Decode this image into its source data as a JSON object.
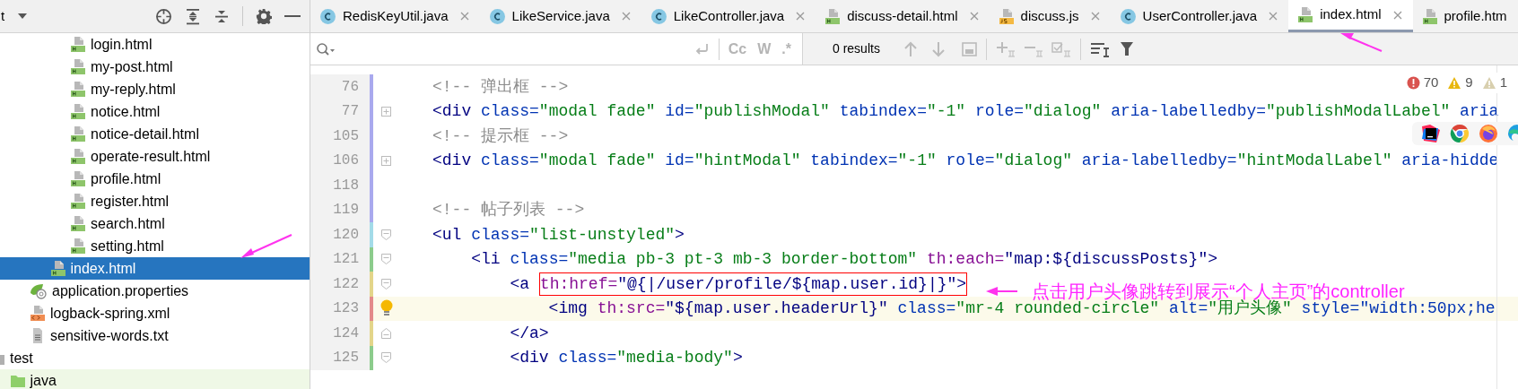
{
  "sidebar": {
    "title": "t",
    "tree": [
      {
        "children": [
          {
            "children": [
              {
                "children": [
                  {
                    "children": [
                      {
                        "label": "login.html",
                        "kind": "html",
                        "selected": false
                      },
                      {
                        "label": "my-post.html",
                        "kind": "html",
                        "selected": false
                      },
                      {
                        "label": "my-reply.html",
                        "kind": "html",
                        "selected": false
                      },
                      {
                        "label": "notice.html",
                        "kind": "html",
                        "selected": false
                      },
                      {
                        "label": "notice-detail.html",
                        "kind": "html",
                        "selected": false
                      },
                      {
                        "label": "operate-result.html",
                        "kind": "html",
                        "selected": false
                      },
                      {
                        "label": "profile.html",
                        "kind": "html",
                        "selected": false
                      },
                      {
                        "label": "register.html",
                        "kind": "html",
                        "selected": false
                      },
                      {
                        "label": "search.html",
                        "kind": "html",
                        "selected": false
                      },
                      {
                        "label": "setting.html",
                        "kind": "html",
                        "selected": false
                      }
                    ]
                  },
                  {
                    "label": "index.html",
                    "kind": "html",
                    "selected": true
                  }
                ]
              },
              {
                "label": "application.properties",
                "kind": "properties",
                "selected": false
              },
              {
                "label": "logback-spring.xml",
                "kind": "xml",
                "selected": false
              },
              {
                "label": "sensitive-words.txt",
                "kind": "text",
                "selected": false
              }
            ]
          }
        ]
      },
      {
        "label": "test",
        "kind": "folder",
        "selected": false,
        "children": [
          {
            "label": "java",
            "kind": "test-folder",
            "selected": false
          }
        ]
      }
    ]
  },
  "tabs": [
    {
      "label": "RedisKeyUtil.java",
      "kind": "java",
      "selected": false,
      "closable": true
    },
    {
      "label": "LikeService.java",
      "kind": "java",
      "selected": false,
      "closable": true
    },
    {
      "label": "LikeController.java",
      "kind": "java",
      "selected": false,
      "closable": true
    },
    {
      "label": "discuss-detail.html",
      "kind": "html",
      "selected": false,
      "closable": true
    },
    {
      "label": "discuss.js",
      "kind": "js",
      "selected": false,
      "closable": true
    },
    {
      "label": "UserController.java",
      "kind": "java",
      "selected": false,
      "closable": true
    },
    {
      "label": "index.html",
      "kind": "html",
      "selected": true,
      "closable": true
    },
    {
      "label": "profile.htm",
      "kind": "html",
      "selected": false,
      "closable": false
    }
  ],
  "find": {
    "options": [
      "Cc",
      "W",
      ".*"
    ],
    "results": "0 results"
  },
  "inspections": [
    {
      "kind": "error",
      "count": "70"
    },
    {
      "kind": "warning",
      "count": "9"
    },
    {
      "kind": "weak",
      "count": "1"
    }
  ],
  "editor": {
    "lines": [
      {
        "number": "76",
        "color": "#a9a9ee",
        "current": false,
        "code": [
          {
            "kind": "comment",
            "text": "<!-- 弹出框 -->"
          }
        ]
      },
      {
        "number": "77",
        "color": "#a9a9ee",
        "current": false,
        "kind": "collapsed",
        "code": [
          {
            "kind": "tag",
            "text": "<div"
          },
          {
            "kind": "attr",
            "text": " class="
          },
          {
            "kind": "value",
            "text": "\"modal fade\""
          },
          {
            "kind": "attr",
            "text": " id="
          },
          {
            "kind": "value",
            "text": "\"publishModal\""
          },
          {
            "kind": "attr",
            "text": " tabindex="
          },
          {
            "kind": "value",
            "text": "\"-1\""
          },
          {
            "kind": "attr",
            "text": " role="
          },
          {
            "kind": "value",
            "text": "\"dialog\""
          },
          {
            "kind": "attr",
            "text": " aria-labelledby="
          },
          {
            "kind": "value",
            "text": "\"publishModalLabel\""
          },
          {
            "kind": "attr",
            "text": " aria"
          }
        ]
      },
      {
        "number": "105",
        "color": "#a9a9ee",
        "current": false,
        "code": [
          {
            "kind": "comment",
            "text": "<!-- 提示框 -->"
          }
        ]
      },
      {
        "number": "106",
        "color": "#a9a9ee",
        "current": false,
        "kind": "collapsed",
        "code": [
          {
            "kind": "tag",
            "text": "<div"
          },
          {
            "kind": "attr",
            "text": " class="
          },
          {
            "kind": "value",
            "text": "\"modal fade\""
          },
          {
            "kind": "attr",
            "text": " id="
          },
          {
            "kind": "value",
            "text": "\"hintModal\""
          },
          {
            "kind": "attr",
            "text": " tabindex="
          },
          {
            "kind": "value",
            "text": "\"-1\""
          },
          {
            "kind": "attr",
            "text": " role="
          },
          {
            "kind": "value",
            "text": "\"dialog\""
          },
          {
            "kind": "attr",
            "text": " aria-labelledby="
          },
          {
            "kind": "value",
            "text": "\"hintModalLabel\""
          },
          {
            "kind": "attr",
            "text": " aria-hidde"
          }
        ]
      },
      {
        "number": "118",
        "color": "#a9a9ee",
        "current": false
      },
      {
        "number": "119",
        "color": "#a9a9ee",
        "current": false,
        "code": [
          {
            "kind": "comment",
            "text": "<!-- 帖子列表 -->"
          }
        ]
      },
      {
        "number": "120",
        "color": "#a3dbe8",
        "current": false,
        "kind": "open",
        "code": [
          {
            "kind": "tag",
            "text": "<ul"
          },
          {
            "kind": "attr",
            "text": " class="
          },
          {
            "kind": "value",
            "text": "\"list-unstyled\""
          },
          {
            "kind": "tag",
            "text": ">"
          }
        ]
      },
      {
        "number": "121",
        "color": "#8ccc8c",
        "current": false,
        "kind": "open",
        "code": [
          {
            "kind": "tag",
            "text": "    <li"
          },
          {
            "kind": "attr",
            "text": " class="
          },
          {
            "kind": "value",
            "text": "\"media pb-3 pt-3 mb-3 border-bottom\""
          },
          {
            "kind": "th",
            "text": " th:each="
          },
          {
            "kind": "expr",
            "text": "\"map:${discussPosts}\""
          },
          {
            "kind": "tag",
            "text": ">"
          }
        ]
      },
      {
        "number": "122",
        "color": "#e3d58a",
        "current": false,
        "kind": "open",
        "code": [
          {
            "kind": "tag",
            "text": "        <a "
          }
        ],
        "boxed": [
          {
            "kind": "th",
            "text": "th:href="
          },
          {
            "kind": "expr",
            "text": "\"@{|/user/profile/${map.user.id}|}\""
          },
          {
            "kind": "tag",
            "text": ">"
          }
        ]
      },
      {
        "number": "123",
        "color": "#e38a8a",
        "current": true,
        "code": [
          {
            "kind": "tag",
            "text": "            <img"
          },
          {
            "kind": "th",
            "text": " th:src="
          },
          {
            "kind": "expr",
            "text": "\"${map.user.headerUrl}\""
          },
          {
            "kind": "attr",
            "text": " class="
          },
          {
            "kind": "value",
            "text": "\"mr-4 rounded-circle\""
          },
          {
            "kind": "attr",
            "text": " alt="
          },
          {
            "kind": "value",
            "text": "\"用户头像\""
          },
          {
            "kind": "attr",
            "text": " style="
          },
          {
            "kind": "css",
            "text": "\"width:50px;he"
          }
        ]
      },
      {
        "number": "124",
        "color": "#e3d58a",
        "current": false,
        "kind": "end",
        "code": [
          {
            "kind": "tag",
            "text": "        </a>"
          }
        ]
      },
      {
        "number": "125",
        "color": "#8ccc8c",
        "current": false,
        "kind": "open",
        "code": [
          {
            "kind": "tag",
            "text": "        <div"
          },
          {
            "kind": "attr",
            "text": " class="
          },
          {
            "kind": "value",
            "text": "\"media-body\""
          },
          {
            "kind": "tag",
            "text": ">"
          }
        ]
      }
    ]
  },
  "callout": {
    "text": "点击用户头像跳转到展示“个人主页”的controller"
  }
}
